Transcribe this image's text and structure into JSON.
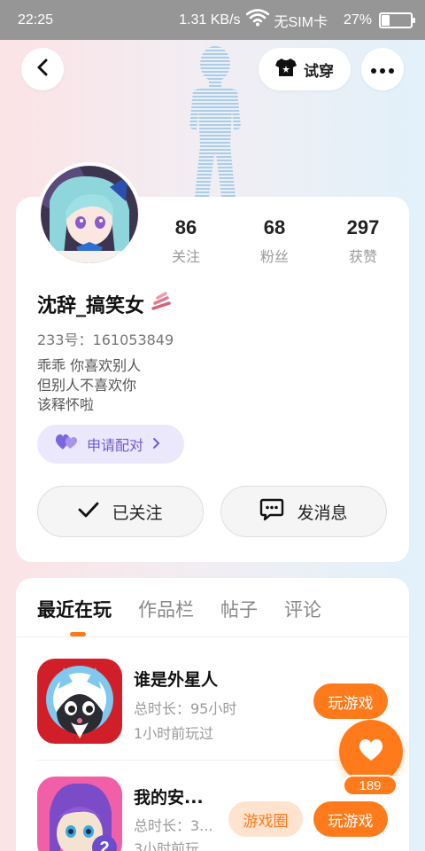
{
  "status_bar": {
    "time": "22:25",
    "speed": "1.31 KB/s",
    "carrier": "无SIM卡",
    "battery": "27%",
    "battery_level": 0.27
  },
  "header": {
    "tryon_label": "试穿"
  },
  "profile": {
    "stats": [
      {
        "value": "86",
        "label": "关注"
      },
      {
        "value": "68",
        "label": "粉丝"
      },
      {
        "value": "297",
        "label": "获赞"
      }
    ],
    "username": "沈辞_搞笑女",
    "uid": "233号：161053849",
    "bio": [
      "乖乖 你喜欢别人",
      "但别人不喜欢你",
      "该释怀啦"
    ],
    "match_label": "申请配对",
    "follow_label": "已关注",
    "message_label": "发消息"
  },
  "tabs": [
    "最近在玩",
    "作品栏",
    "帖子",
    "评论"
  ],
  "games": [
    {
      "title": "谁是外星人",
      "duration": "总时长：95小时",
      "last_played": "1小时前玩过",
      "play_label": "玩游戏"
    },
    {
      "title": "我的安...",
      "duration": "总时长：3...",
      "last_played": "3小时前玩",
      "circle_label": "游戏圈",
      "play_label": "玩游戏"
    }
  ],
  "like_count": "189",
  "colors": {
    "accent": "#ff7a1a",
    "purple": "#6d5bd8"
  }
}
